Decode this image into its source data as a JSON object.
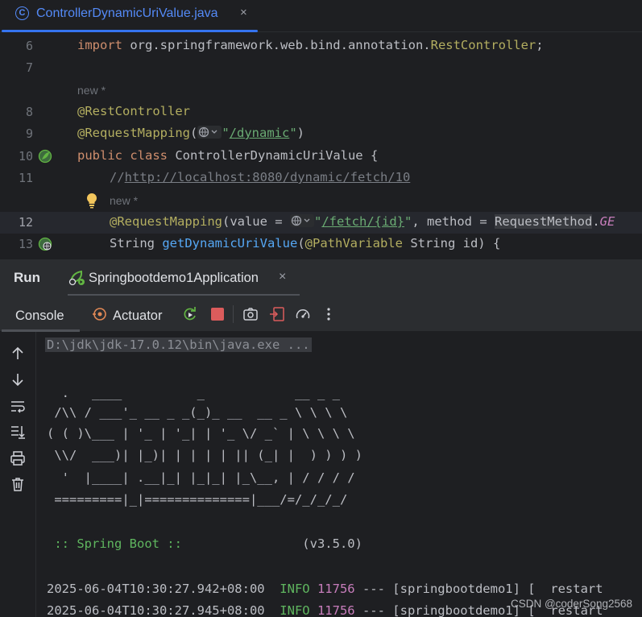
{
  "editor_tab": {
    "filename": "ControllerDynamicUriValue.java",
    "close": "×",
    "icon": "java-class-icon"
  },
  "editor": {
    "lines": {
      "l6": {
        "num": "6",
        "kw": "import",
        "rest": " org.springframework.web.bind.annotation.",
        "cls": "RestController",
        "end": ";"
      },
      "l7": {
        "num": "7"
      },
      "hint1": "new *",
      "l8": {
        "num": "8",
        "ann": "@RestController"
      },
      "l9": {
        "num": "9",
        "ann": "@RequestMapping",
        "open": "(",
        "str_q": "\"",
        "path": "/dynamic",
        "str_q2": "\"",
        "close": ")"
      },
      "l10": {
        "num": "10",
        "kw1": "public",
        "kw2": "class",
        "rest": " ControllerDynamicUriValue {"
      },
      "l11": {
        "num": "11",
        "cmt": "//",
        "link": "http://localhost:8080/dynamic/fetch/10"
      },
      "hint2": "new *",
      "l12": {
        "num": "12",
        "ann": "@RequestMapping",
        "p1": "(value = ",
        "q": "\"",
        "path": "/fetch/{id}",
        "q2": "\"",
        "p2": ", method = ",
        "hl": "RequestMethod",
        "dot": ".",
        "tail": "GE"
      },
      "l13": {
        "num": "13",
        "t1": "String ",
        "fn": "getDynamicUriValue",
        "p1": "(",
        "ann": "@PathVariable",
        "p2": " String id) {"
      }
    }
  },
  "run": {
    "title": "Run",
    "app_tab": "Springbootdemo1Application",
    "app_close": "×",
    "console_tab": "Console",
    "actuator_tab": "Actuator"
  },
  "console": {
    "command": "D:\\jdk\\jdk-17.0.12\\bin\\java.exe ...",
    "banner": [
      "  .   ____          _            __ _ _",
      " /\\\\ / ___'_ __ _ _(_)_ __  __ _ \\ \\ \\ \\",
      "( ( )\\___ | '_ | '_| | '_ \\/ _` | \\ \\ \\ \\",
      " \\\\/  ___)| |_)| | | | | || (_| |  ) ) ) )",
      "  '  |____| .__|_| |_|_| |_\\__, | / / / /",
      " =========|_|==============|___/=/_/_/_/"
    ],
    "spring_boot": " :: Spring Boot :: ",
    "version": "               (v3.5.0)",
    "logs": [
      {
        "ts": "2025-06-04T10:30:27.942+08:00",
        "level": "INFO",
        "pid": "11756",
        "rest": " --- [springbootdemo1] [  restart"
      },
      {
        "ts": "2025-06-04T10:30:27.945+08:00",
        "level": "INFO",
        "pid": "11756",
        "rest": " --- [springbootdemo1] [  restart"
      }
    ]
  },
  "watermark": "CSDN @coderSong2568",
  "colors": {
    "accent": "#3574f0",
    "keyword": "#cf8e6d",
    "annotation": "#b3ae60",
    "string": "#6aab73",
    "function": "#56a8f5",
    "info": "#5fb65f",
    "pid": "#c77dbb"
  }
}
